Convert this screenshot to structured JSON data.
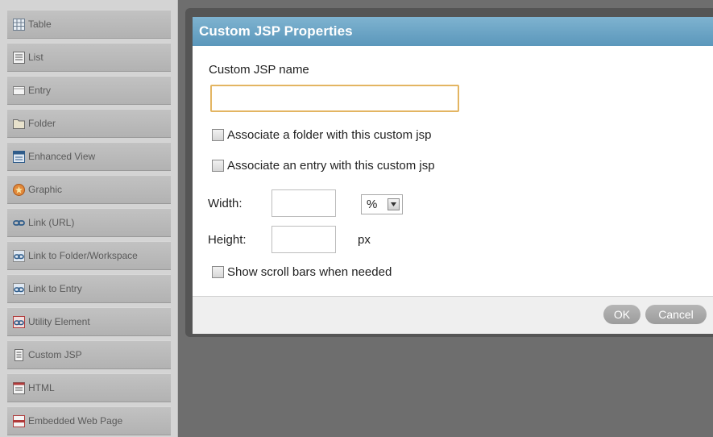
{
  "palette": {
    "items": [
      {
        "label": "Table",
        "icon": "table-icon"
      },
      {
        "label": "List",
        "icon": "list-icon"
      },
      {
        "label": "Entry",
        "icon": "entry-icon"
      },
      {
        "label": "Folder",
        "icon": "folder-icon"
      },
      {
        "label": "Enhanced View",
        "icon": "enhanced-view-icon"
      },
      {
        "label": "Graphic",
        "icon": "graphic-icon"
      },
      {
        "label": "Link (URL)",
        "icon": "link-icon"
      },
      {
        "label": "Link to Folder/Workspace",
        "icon": "link-folder-icon"
      },
      {
        "label": "Link to Entry",
        "icon": "link-entry-icon"
      },
      {
        "label": "Utility Element",
        "icon": "utility-element-icon"
      },
      {
        "label": "Custom JSP",
        "icon": "custom-jsp-icon"
      },
      {
        "label": "HTML",
        "icon": "html-icon"
      },
      {
        "label": "Embedded Web Page",
        "icon": "embedded-web-page-icon"
      }
    ]
  },
  "dialog": {
    "title": "Custom JSP Properties",
    "name_label": "Custom JSP name",
    "name_value": "",
    "associate_folder_label": "Associate a folder with this custom jsp",
    "associate_folder_checked": false,
    "associate_entry_label": "Associate an entry with this custom jsp",
    "associate_entry_checked": false,
    "width_label": "Width:",
    "width_value": "",
    "width_unit": "%",
    "height_label": "Height:",
    "height_value": "",
    "height_unit": "px",
    "scroll_label": "Show scroll bars when needed",
    "scroll_checked": false,
    "ok_label": "OK",
    "cancel_label": "Cancel"
  },
  "colors": {
    "header": "#6aa4c6",
    "input_focus_border": "#e3b562",
    "backdrop": "#6e6e6e"
  }
}
